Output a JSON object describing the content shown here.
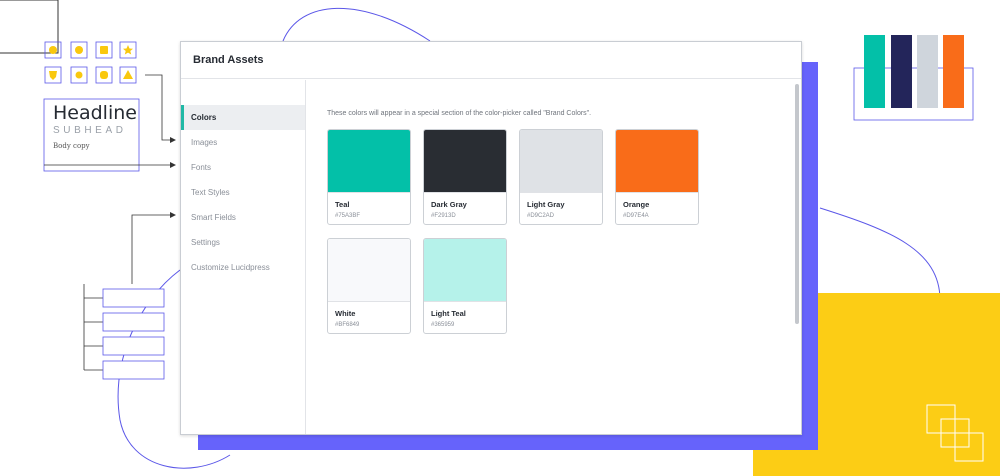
{
  "dialog": {
    "title": "Brand Assets"
  },
  "sidebar": {
    "items": [
      {
        "label": "Colors"
      },
      {
        "label": "Images"
      },
      {
        "label": "Fonts"
      },
      {
        "label": "Text Styles"
      },
      {
        "label": "Smart Fields"
      },
      {
        "label": "Settings"
      },
      {
        "label": "Customize Lucidpress"
      }
    ]
  },
  "content": {
    "description": "These colors will appear in a special section of the color-picker called \"Brand Colors\".",
    "swatches": [
      {
        "name": "Teal",
        "hex": "#75A3BF",
        "color": "#03c0a8"
      },
      {
        "name": "Dark Gray",
        "hex": "#F2913D",
        "color": "#292d33"
      },
      {
        "name": "Light Gray",
        "hex": "#D9C2AD",
        "color": "#dfe2e6"
      },
      {
        "name": "Orange",
        "hex": "#D97E4A",
        "color": "#f96c19"
      },
      {
        "name": "White",
        "hex": "#BF6849",
        "color": "#f8f9fb"
      },
      {
        "name": "Light Teal",
        "hex": "#365959",
        "color": "#b5f2ea"
      }
    ]
  },
  "decoration": {
    "headline": "Headline",
    "subhead": "SUBHEAD",
    "body": "Body copy",
    "colors": {
      "accent_purple": "#6663fb",
      "accent_yellow": "#fccd15",
      "icon_yellow": "#f9c80e",
      "outline": "#5b57e8"
    }
  }
}
